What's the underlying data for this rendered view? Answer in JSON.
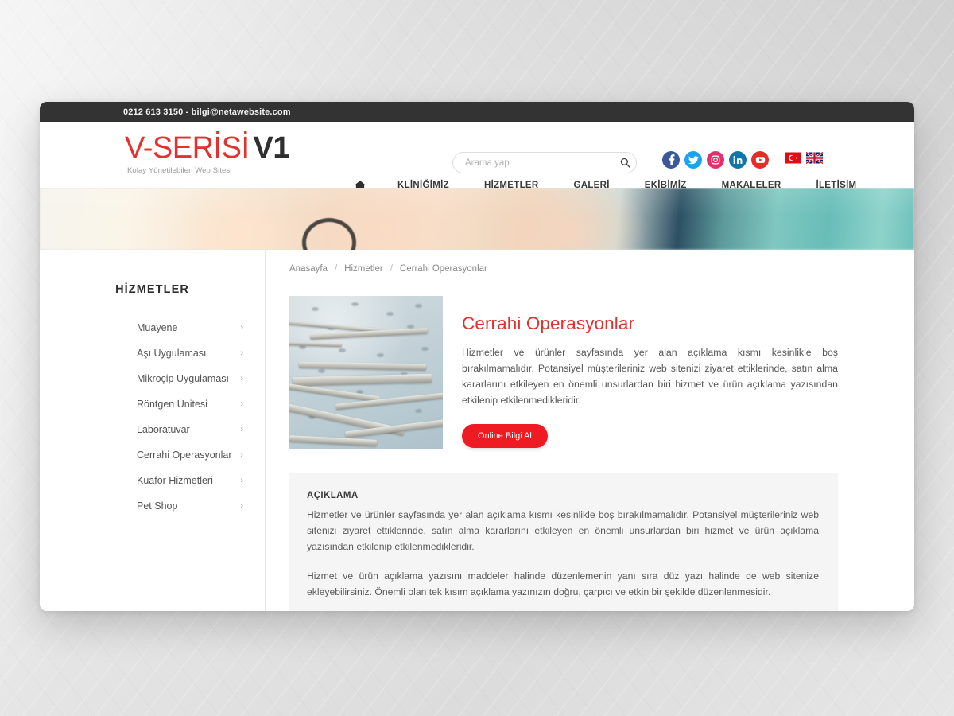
{
  "topbar": {
    "contact": "0212 613 3150 - bilgi@netawebsite.com"
  },
  "header": {
    "logo_main": "V-SERİSİ",
    "logo_suffix": "V1",
    "logo_subtitle": "Kolay Yönetilebilen Web Sitesi",
    "search": {
      "placeholder": "Arama yap",
      "value": "",
      "icon": "search-icon"
    },
    "socials": [
      {
        "name": "facebook",
        "glyph": "f",
        "color": "#3b5998"
      },
      {
        "name": "twitter",
        "glyph": "t",
        "color": "#1da1f2"
      },
      {
        "name": "instagram",
        "glyph": "i",
        "color": "#e1306c"
      },
      {
        "name": "linkedin",
        "glyph": "in",
        "color": "#0e76a8"
      },
      {
        "name": "youtube",
        "glyph": "y",
        "color": "#e52d27"
      }
    ],
    "languages": [
      {
        "name": "turkish-flag",
        "label": "TR"
      },
      {
        "name": "english-flag",
        "label": "EN"
      }
    ],
    "nav": [
      {
        "label": "",
        "icon": "home-icon",
        "name": "home"
      },
      {
        "label": "KLİNİĞİMİZ",
        "name": "klinigimiz"
      },
      {
        "label": "HİZMETLER",
        "name": "hizmetler"
      },
      {
        "label": "GALERİ",
        "name": "galeri"
      },
      {
        "label": "EKİBİMİZ",
        "name": "ekibimiz"
      },
      {
        "label": "MAKALELER",
        "name": "makaleler"
      },
      {
        "label": "İLETİŞİM",
        "name": "iletisim"
      }
    ]
  },
  "sidebar": {
    "title": "HİZMETLER",
    "items": [
      {
        "label": "Muayene"
      },
      {
        "label": "Aşı Uygulaması"
      },
      {
        "label": "Mikroçip Uygulaması"
      },
      {
        "label": "Röntgen Ünitesi"
      },
      {
        "label": "Laboratuvar"
      },
      {
        "label": "Cerrahi Operasyonlar"
      },
      {
        "label": "Kuaför Hizmetleri"
      },
      {
        "label": "Pet Shop"
      }
    ],
    "chevron": "›"
  },
  "breadcrumb": {
    "separator": "/",
    "items": [
      {
        "label": "Anasayfa"
      },
      {
        "label": "Hizmetler"
      },
      {
        "label": "Cerrahi Operasyonlar"
      }
    ]
  },
  "product": {
    "image_alt": "surgical-instruments-photo",
    "title": "Cerrahi Operasyonlar",
    "description": "Hizmetler ve ürünler sayfasında yer alan açıklama kısmı kesinlikle boş bırakılmamalıdır. Potansiyel müşterileriniz web sitenizi ziyaret ettiklerinde, satın alma kararlarını etkileyen en önemli unsurlardan biri hizmet ve ürün açıklama yazısından etkilenip etkilenmedikleridir.",
    "cta_label": "Online Bilgi Al"
  },
  "description_panel": {
    "heading": "AÇIKLAMA",
    "paragraph1": "Hizmetler ve ürünler sayfasında yer alan açıklama kısmı kesinlikle boş bırakılmamalıdır. Potansiyel müşterileriniz web sitenizi ziyaret ettiklerinde, satın alma kararlarını etkileyen en önemli unsurlardan biri hizmet ve ürün açıklama yazısından etkilenip etkilenmedikleridir.",
    "paragraph2": "Hizmet ve ürün açıklama yazısını maddeler halinde düzenlemenin yanı sıra düz yazı halinde de web sitenize ekleyebilirsiniz. Önemli olan tek kısım açıklama yazınızın doğru, çarpıcı ve etkin bir şekilde düzenlenmesidir."
  },
  "colors": {
    "accent_red": "#e1332d",
    "cta_red": "#ee1c22",
    "topbar_dark": "#333333",
    "panel_gray": "#f5f5f5"
  }
}
